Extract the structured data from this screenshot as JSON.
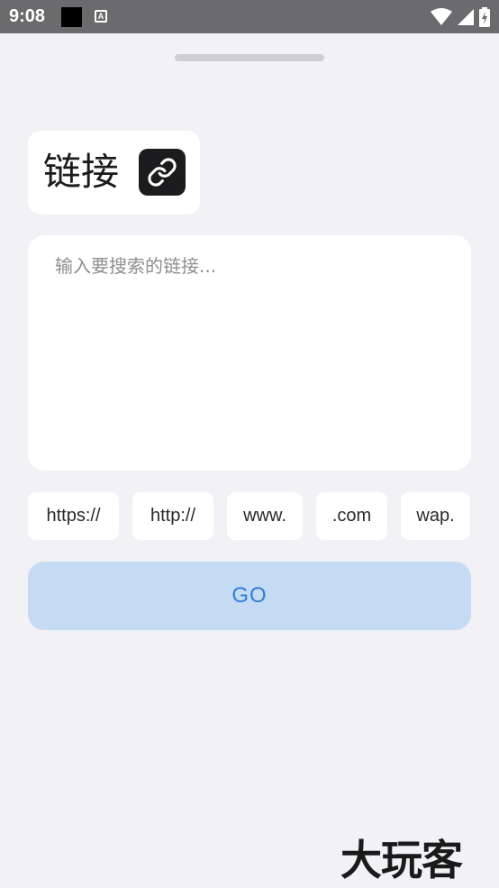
{
  "status_bar": {
    "time": "9:08"
  },
  "title_card": {
    "title": "链接",
    "icon": "link-icon"
  },
  "input": {
    "placeholder": "输入要搜索的链接...",
    "value": ""
  },
  "quick_chips": [
    {
      "label": "https://"
    },
    {
      "label": "http://"
    },
    {
      "label": "www."
    },
    {
      "label": ".com"
    },
    {
      "label": "wap."
    }
  ],
  "go_button": {
    "label": "GO"
  },
  "watermark": {
    "text": "大玩客"
  },
  "colors": {
    "background": "#f1f1f6",
    "card": "#ffffff",
    "go_bg": "#c5daf3",
    "go_text": "#2f7fd8",
    "status_bar": "#6b6b6e"
  }
}
